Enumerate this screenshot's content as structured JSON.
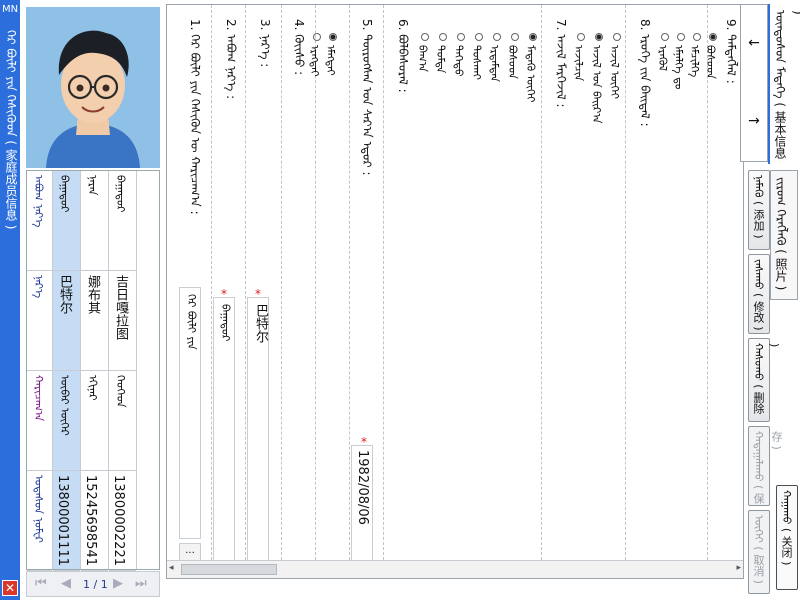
{
  "window": {
    "lang_label": "MN",
    "title": "ᠭᠡᠷ ᠪᠦᠯᠢ ᠶᠢᠨ ᠭᠡᠰᠢᠭᠦᠳ ( 家庭成员信息 )",
    "close_label": "✕"
  },
  "tabs": {
    "basic_info": "ᠦᠨᠳᠦᠰᠦᠨ ᠮᠡᠳᠡᠭᠡ ( 基本信息 )",
    "photo": "ᠵᠢᠷᠤᠭ ᠬᠡᠷᠡᠭᠯᠡᠬᠦ ( 照片 )",
    "prev_icon": "arrow-up",
    "next_icon": "arrow-down"
  },
  "buttons": {
    "add": "ᠨᠡᠮᠡᠬᠦ ( 添加 )",
    "edit": "ᠵᠠᠰᠠᠬᠤ ( 修改 )",
    "delete": "ᠬᠠᠰᠤᠬᠤ ( 删除 )",
    "save": "ᠬᠠᠳᠠᠭᠠᠯᠠᠬᠤ ( 保存 )",
    "cancel": "ᠦᠬᠡᠢ ( 取消 )",
    "close": "ᠬᠠᠭᠠᠬᠤ ( 关闭 )"
  },
  "form": {
    "q1": {
      "label": "1. ᠭᠡᠷ ᠪᠦᠯᠢ ᠶᠢᠨ ᠭᠡᠰᠢᠭᠦᠨ ᠦ ᠬᠠᠷᠢᠴᠠᠭ᠎ᠠ :",
      "value": "ᠭᠡᠷ ᠪᠦᠯᠢ ᠶᠢᠨ",
      "btn": "..."
    },
    "q2": {
      "label": "2. ᠠᠪᠤᠭ ᠨᠡᠷ᠎ᠡ :",
      "value": "ᠪᠠᠭᠠᠲᠤᠷ"
    },
    "q3": {
      "label": "3. ᠨᠡᠷ᠎ᠡ :",
      "value": "巴特尔"
    },
    "q4": {
      "label": "4. ᠬᠦᠢᠰᠦ :",
      "options": [
        "ᠡᠷᠡᠭᠲᠡᠢ",
        "ᠡᠮᠡᠭᠲᠡᠢ"
      ],
      "selected_index": 1
    },
    "q5": {
      "label": "5. ᠲᠥᠷᠦᠭᠰᠡᠨ ᠣᠨ ᠰᠠᠷ᠎ᠠ ᠡᠳᠦᠷ :",
      "value": "1982/08/06"
    },
    "q6": {
      "label": "6. ᠪᠣᠯᠪᠠᠰᠤᠷᠠᠯ :",
      "options": [
        "ᠪᠠᠭ᠎ᠠ",
        "ᠳᠤᠮᠳᠠ",
        "ᠳᠡᠭᠡᠳᠦ",
        "ᠲᠤᠰᠬᠠᠢ",
        "ᠡᠷᠳᠡᠮᠲᠡᠨ",
        "ᠪᠤᠰᠤᠳ",
        "ᠮᠡᠳᠡᠬᠦ ᠦᠭᠡᠢ"
      ],
      "selected_index": 6
    },
    "q7": {
      "label": "7. ᠠᠵᠢᠯ ᠮᠡᠷᠭᠡᠵᠢᠯ :",
      "options": [
        "ᠠᠵᠢᠯᠴᠢᠨ",
        "ᠠᠵᠢᠯ ᠤᠨ ᠪᠠᠢᠷ᠎ᠠ",
        "ᠠᠵᠢᠯ ᠦᠭᠡᠢ"
      ],
      "selected_index": 1
    },
    "q8": {
      "label": "8. ᠡᠷᠦᠬᠡ ᠵᠢᠨ ᠪᠠᠢᠳᠠᠯ :",
      "options": [
        "ᠡᠷᠡᠭᠦᠯ",
        "ᠡᠮᠨᠡᠯᠭᠡ ᠳᠤ",
        "ᠡᠮᠴᠢᠯᠭᠡ",
        "ᠪᠤᠰᠤᠳ"
      ],
      "selected_index": 3
    },
    "q9": {
      "label": "9. ᠲᠡᠮᠳᠡᠭᠯᠡᠯ :"
    }
  },
  "family_table": {
    "headers": [
      "ᠠᠪᠤᠭ ᠨᠡᠷ᠎ᠡ",
      "ᠨᠡᠷ᠎ᠡ",
      "ᠬᠠᠷᠢᠴᠠᠭ᠎ᠠ",
      "ᠤᠲᠠᠰᠤᠨ ᠨᠣᠮᠧᠷ"
    ],
    "rows": [
      {
        "surname": "ᠪᠠᠭᠠᠲᠤᠷ",
        "name": "吉日嘎拉图",
        "relation": "ᠬᠡᠦᠬᠡᠳ",
        "phone": "13800002221"
      },
      {
        "surname": "ᠨᠠᠷᠠᠨ",
        "name": "娜布其",
        "relation": "ᠡᠬᠢᠨᠡᠷ",
        "phone": "15245698541"
      },
      {
        "surname": "ᠪᠠᠭᠠᠲᠤᠷ",
        "name": "巴特尔",
        "relation": "ᠥᠪᠡᠷ ᠥᠭᠡᠷ",
        "phone": "13800001111"
      }
    ],
    "pager": {
      "text": "1 / 1"
    }
  }
}
